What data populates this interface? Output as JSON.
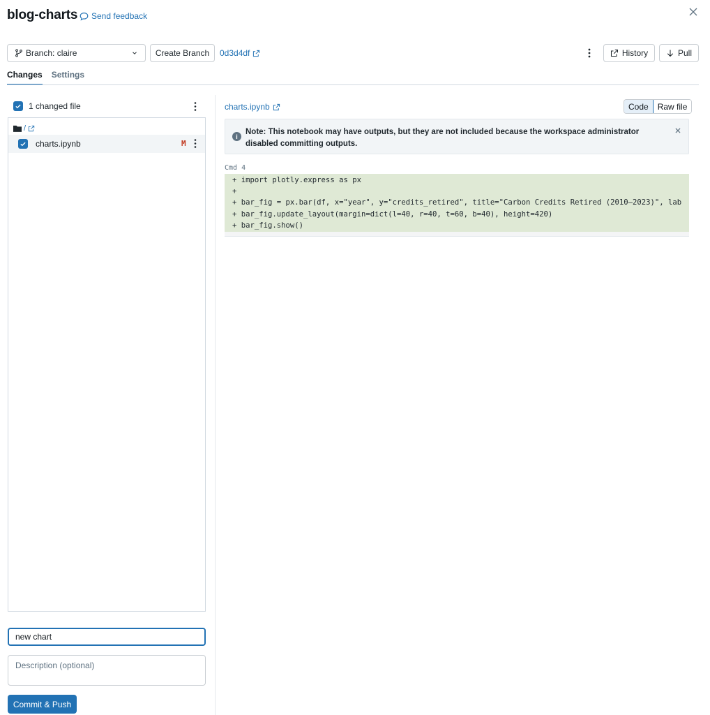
{
  "header": {
    "title": "blog-charts",
    "feedback_label": "Send feedback"
  },
  "toolbar": {
    "branch_label": "Branch: claire",
    "create_branch_label": "Create Branch",
    "commit_hash": "0d3d4df",
    "history_label": "History",
    "pull_label": "Pull"
  },
  "tabs": [
    {
      "label": "Changes",
      "active": true
    },
    {
      "label": "Settings",
      "active": false
    }
  ],
  "changes": {
    "changed_files_label": "1 changed file",
    "folder_path": "/",
    "files": [
      {
        "name": "charts.ipynb",
        "status": "M"
      }
    ],
    "commit_message_value": "new chart",
    "description_placeholder": "Description (optional)",
    "commit_button_label": "Commit & Push"
  },
  "viewer": {
    "file_name": "charts.ipynb",
    "view_modes": [
      {
        "label": "Code",
        "active": true
      },
      {
        "label": "Raw file",
        "active": false
      }
    ],
    "note_text": "Note: This notebook may have outputs, but they are not included because the workspace administrator disabled committing outputs.",
    "cmd_label": "Cmd 4",
    "diff_lines": [
      "+ import plotly.express as px",
      "+",
      "+ bar_fig = px.bar(df, x=\"year\", y=\"credits_retired\", title=\"Carbon Credits Retired (2010–2023)\", lab",
      "+ bar_fig.update_layout(margin=dict(l=40, r=40, t=60, b=40), height=420)",
      "+ bar_fig.show()"
    ]
  },
  "colors": {
    "accent": "#2272b4",
    "diff_added_bg": "#dfe9d5",
    "modified_badge": "#c23b22"
  }
}
